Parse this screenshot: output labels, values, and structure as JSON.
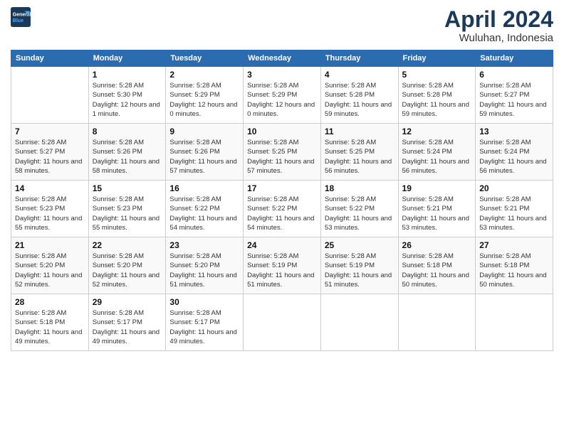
{
  "logo": {
    "line1": "General",
    "line2": "Blue"
  },
  "title": "April 2024",
  "location": "Wuluhan, Indonesia",
  "weekdays": [
    "Sunday",
    "Monday",
    "Tuesday",
    "Wednesday",
    "Thursday",
    "Friday",
    "Saturday"
  ],
  "weeks": [
    [
      {
        "day": null,
        "sunrise": null,
        "sunset": null,
        "daylight": null
      },
      {
        "day": "1",
        "sunrise": "Sunrise: 5:28 AM",
        "sunset": "Sunset: 5:30 PM",
        "daylight": "Daylight: 12 hours and 1 minute."
      },
      {
        "day": "2",
        "sunrise": "Sunrise: 5:28 AM",
        "sunset": "Sunset: 5:29 PM",
        "daylight": "Daylight: 12 hours and 0 minutes."
      },
      {
        "day": "3",
        "sunrise": "Sunrise: 5:28 AM",
        "sunset": "Sunset: 5:29 PM",
        "daylight": "Daylight: 12 hours and 0 minutes."
      },
      {
        "day": "4",
        "sunrise": "Sunrise: 5:28 AM",
        "sunset": "Sunset: 5:28 PM",
        "daylight": "Daylight: 11 hours and 59 minutes."
      },
      {
        "day": "5",
        "sunrise": "Sunrise: 5:28 AM",
        "sunset": "Sunset: 5:28 PM",
        "daylight": "Daylight: 11 hours and 59 minutes."
      },
      {
        "day": "6",
        "sunrise": "Sunrise: 5:28 AM",
        "sunset": "Sunset: 5:27 PM",
        "daylight": "Daylight: 11 hours and 59 minutes."
      }
    ],
    [
      {
        "day": "7",
        "sunrise": "Sunrise: 5:28 AM",
        "sunset": "Sunset: 5:27 PM",
        "daylight": "Daylight: 11 hours and 58 minutes."
      },
      {
        "day": "8",
        "sunrise": "Sunrise: 5:28 AM",
        "sunset": "Sunset: 5:26 PM",
        "daylight": "Daylight: 11 hours and 58 minutes."
      },
      {
        "day": "9",
        "sunrise": "Sunrise: 5:28 AM",
        "sunset": "Sunset: 5:26 PM",
        "daylight": "Daylight: 11 hours and 57 minutes."
      },
      {
        "day": "10",
        "sunrise": "Sunrise: 5:28 AM",
        "sunset": "Sunset: 5:25 PM",
        "daylight": "Daylight: 11 hours and 57 minutes."
      },
      {
        "day": "11",
        "sunrise": "Sunrise: 5:28 AM",
        "sunset": "Sunset: 5:25 PM",
        "daylight": "Daylight: 11 hours and 56 minutes."
      },
      {
        "day": "12",
        "sunrise": "Sunrise: 5:28 AM",
        "sunset": "Sunset: 5:24 PM",
        "daylight": "Daylight: 11 hours and 56 minutes."
      },
      {
        "day": "13",
        "sunrise": "Sunrise: 5:28 AM",
        "sunset": "Sunset: 5:24 PM",
        "daylight": "Daylight: 11 hours and 56 minutes."
      }
    ],
    [
      {
        "day": "14",
        "sunrise": "Sunrise: 5:28 AM",
        "sunset": "Sunset: 5:23 PM",
        "daylight": "Daylight: 11 hours and 55 minutes."
      },
      {
        "day": "15",
        "sunrise": "Sunrise: 5:28 AM",
        "sunset": "Sunset: 5:23 PM",
        "daylight": "Daylight: 11 hours and 55 minutes."
      },
      {
        "day": "16",
        "sunrise": "Sunrise: 5:28 AM",
        "sunset": "Sunset: 5:22 PM",
        "daylight": "Daylight: 11 hours and 54 minutes."
      },
      {
        "day": "17",
        "sunrise": "Sunrise: 5:28 AM",
        "sunset": "Sunset: 5:22 PM",
        "daylight": "Daylight: 11 hours and 54 minutes."
      },
      {
        "day": "18",
        "sunrise": "Sunrise: 5:28 AM",
        "sunset": "Sunset: 5:22 PM",
        "daylight": "Daylight: 11 hours and 53 minutes."
      },
      {
        "day": "19",
        "sunrise": "Sunrise: 5:28 AM",
        "sunset": "Sunset: 5:21 PM",
        "daylight": "Daylight: 11 hours and 53 minutes."
      },
      {
        "day": "20",
        "sunrise": "Sunrise: 5:28 AM",
        "sunset": "Sunset: 5:21 PM",
        "daylight": "Daylight: 11 hours and 53 minutes."
      }
    ],
    [
      {
        "day": "21",
        "sunrise": "Sunrise: 5:28 AM",
        "sunset": "Sunset: 5:20 PM",
        "daylight": "Daylight: 11 hours and 52 minutes."
      },
      {
        "day": "22",
        "sunrise": "Sunrise: 5:28 AM",
        "sunset": "Sunset: 5:20 PM",
        "daylight": "Daylight: 11 hours and 52 minutes."
      },
      {
        "day": "23",
        "sunrise": "Sunrise: 5:28 AM",
        "sunset": "Sunset: 5:20 PM",
        "daylight": "Daylight: 11 hours and 51 minutes."
      },
      {
        "day": "24",
        "sunrise": "Sunrise: 5:28 AM",
        "sunset": "Sunset: 5:19 PM",
        "daylight": "Daylight: 11 hours and 51 minutes."
      },
      {
        "day": "25",
        "sunrise": "Sunrise: 5:28 AM",
        "sunset": "Sunset: 5:19 PM",
        "daylight": "Daylight: 11 hours and 51 minutes."
      },
      {
        "day": "26",
        "sunrise": "Sunrise: 5:28 AM",
        "sunset": "Sunset: 5:18 PM",
        "daylight": "Daylight: 11 hours and 50 minutes."
      },
      {
        "day": "27",
        "sunrise": "Sunrise: 5:28 AM",
        "sunset": "Sunset: 5:18 PM",
        "daylight": "Daylight: 11 hours and 50 minutes."
      }
    ],
    [
      {
        "day": "28",
        "sunrise": "Sunrise: 5:28 AM",
        "sunset": "Sunset: 5:18 PM",
        "daylight": "Daylight: 11 hours and 49 minutes."
      },
      {
        "day": "29",
        "sunrise": "Sunrise: 5:28 AM",
        "sunset": "Sunset: 5:17 PM",
        "daylight": "Daylight: 11 hours and 49 minutes."
      },
      {
        "day": "30",
        "sunrise": "Sunrise: 5:28 AM",
        "sunset": "Sunset: 5:17 PM",
        "daylight": "Daylight: 11 hours and 49 minutes."
      },
      {
        "day": null,
        "sunrise": null,
        "sunset": null,
        "daylight": null
      },
      {
        "day": null,
        "sunrise": null,
        "sunset": null,
        "daylight": null
      },
      {
        "day": null,
        "sunrise": null,
        "sunset": null,
        "daylight": null
      },
      {
        "day": null,
        "sunrise": null,
        "sunset": null,
        "daylight": null
      }
    ]
  ]
}
